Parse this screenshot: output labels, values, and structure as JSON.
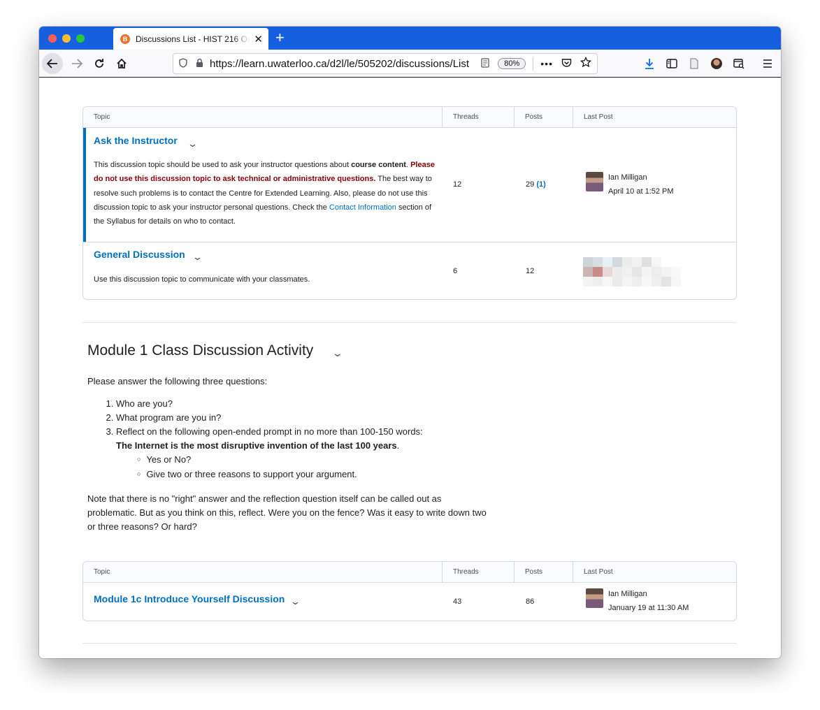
{
  "browser": {
    "tab_title": "Discussions List - HIST 216 Onl",
    "favicon_letter": "B",
    "close_glyph": "✕",
    "new_tab_glyph": "+",
    "url": "https://learn.uwaterloo.ca/d2l/le/505202/discussions/List",
    "zoom": "80%",
    "more_glyph": "•••"
  },
  "table_headers": {
    "topic": "Topic",
    "threads": "Threads",
    "posts": "Posts",
    "last_post": "Last Post"
  },
  "topics_1": [
    {
      "title": "Ask the Instructor",
      "desc_part1": "This discussion topic should be used to ask your instructor questions about ",
      "desc_bold": "course content",
      "desc_part2": ". ",
      "desc_warning": "Please do not use this discussion topic to ask technical or administrative questions.",
      "desc_part3": " The best way to resolve such problems is to contact the Centre for Extended Learning. Also, please do not use this discussion topic to ask your instructor personal questions. Check the ",
      "desc_link": "Contact Information",
      "desc_part4": " section of the Syllabus for details on who to contact.",
      "threads": "12",
      "posts": "29",
      "unread": "(1)",
      "last_post_name": "Ian Milligan",
      "last_post_date": "April 10 at 1:52 PM"
    },
    {
      "title": "General Discussion",
      "desc": "Use this discussion topic to communicate with your classmates.",
      "threads": "6",
      "posts": "12"
    }
  ],
  "module": {
    "title": "Module 1 Class Discussion Activity",
    "intro": "Please answer the following three questions:",
    "questions": [
      "Who are you?",
      "What program are you in?",
      "Reflect on the following open-ended prompt in no more than 100-150 words:"
    ],
    "prompt": "The Internet is the most disruptive invention of the last 100 years",
    "prompt_end": ".",
    "sub_items": [
      "Yes or No?",
      "Give two or three reasons to support your argument."
    ],
    "note": "Note that there is no \"right\" answer and the reflection question itself can be called out as problematic. But as you think on this, reflect. Were you on the fence? Was it easy to write down two or three reasons? Or hard?"
  },
  "topics_2": [
    {
      "title": "Module 1c Introduce Yourself Discussion",
      "threads": "43",
      "posts": "86",
      "last_post_name": "Ian Milligan",
      "last_post_date": "January 19 at 11:30 AM"
    }
  ],
  "colors": {
    "accent": "#006fbf",
    "warning": "#8b0000",
    "tabbar": "#1660e0"
  }
}
